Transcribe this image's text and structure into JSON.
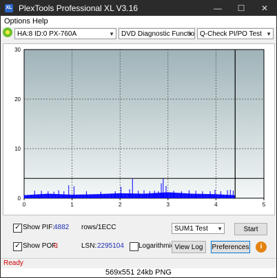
{
  "window": {
    "title": "PlexTools Professional XL V3.16",
    "app_icon_text": "XL",
    "minimize_glyph": "—",
    "maximize_glyph": "☐",
    "close_glyph": "✕"
  },
  "menu": {
    "items": [
      "Options",
      "Help"
    ]
  },
  "toolbar": {
    "drive": "HA:8 ID:0  PX-760A",
    "function": "DVD Diagnostic Functions",
    "test": "Q-Check PI/PO Test",
    "dropdown_glyph": "▼"
  },
  "chart_data": {
    "type": "bar",
    "x_ticks": [
      "0",
      "1",
      "2",
      "3",
      "4",
      "5"
    ],
    "y_ticks": [
      "0",
      "10",
      "20",
      "30"
    ],
    "xlim": [
      0,
      5
    ],
    "ylim": [
      0,
      30
    ],
    "grid": true,
    "threshold_line": 4,
    "end_marker_x": 4.4,
    "colors": {
      "bars": "#0000ff",
      "threshold": "#000000",
      "bg_top": "#9fb3b8",
      "bg_bottom": "#f4f8f8"
    },
    "baseline_dense": [
      [
        0.0,
        0.6
      ],
      [
        0.5,
        0.9
      ],
      [
        1.0,
        0.7
      ],
      [
        1.5,
        0.8
      ],
      [
        2.0,
        1.0
      ],
      [
        2.5,
        0.9
      ],
      [
        3.0,
        1.2
      ],
      [
        3.5,
        0.9
      ],
      [
        4.0,
        0.8
      ],
      [
        4.4,
        0.6
      ]
    ],
    "spikes": [
      [
        0.22,
        1.5
      ],
      [
        0.36,
        1.5
      ],
      [
        0.5,
        1.4
      ],
      [
        0.62,
        1.3
      ],
      [
        0.72,
        1.6
      ],
      [
        0.83,
        1.4
      ],
      [
        0.93,
        2.6
      ],
      [
        1.04,
        2.4
      ],
      [
        1.3,
        1.4
      ],
      [
        1.6,
        1.3
      ],
      [
        1.9,
        1.4
      ],
      [
        2.02,
        2.3
      ],
      [
        2.2,
        1.8
      ],
      [
        2.26,
        3.9
      ],
      [
        2.38,
        1.5
      ],
      [
        2.5,
        1.6
      ],
      [
        2.62,
        1.4
      ],
      [
        2.72,
        1.5
      ],
      [
        2.8,
        1.4
      ],
      [
        2.86,
        3.0
      ],
      [
        2.9,
        4.0
      ],
      [
        2.96,
        2.5
      ],
      [
        3.12,
        1.5
      ],
      [
        3.28,
        1.4
      ],
      [
        3.44,
        1.6
      ],
      [
        3.58,
        1.5
      ],
      [
        3.72,
        1.4
      ],
      [
        3.88,
        1.4
      ],
      [
        3.98,
        1.7
      ],
      [
        4.1,
        1.4
      ],
      [
        4.24,
        1.6
      ],
      [
        4.3,
        1.7
      ],
      [
        4.36,
        1.5
      ]
    ]
  },
  "pif": {
    "label": "Show PIF:",
    "value": "4882",
    "unit": "rows/1ECC",
    "checked": "✓"
  },
  "pof": {
    "label": "Show POF:",
    "value": "0",
    "checked": "✓"
  },
  "lsn": {
    "label": "LSN:",
    "value": "2295104"
  },
  "log": {
    "label": "Logarithmic",
    "checked": ""
  },
  "mode_select": {
    "value": "SUM1 Test"
  },
  "buttons": {
    "start": "Start",
    "view_log": "View Log",
    "preferences": "Preferences",
    "info": "i"
  },
  "status": {
    "text": "Ready"
  },
  "caption": {
    "text": "569x551 24kb PNG"
  }
}
